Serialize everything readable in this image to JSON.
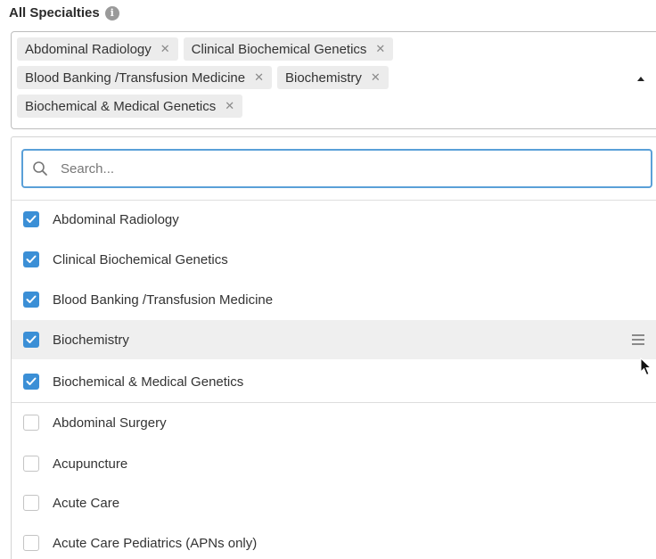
{
  "field": {
    "label": "All Specialties",
    "info_icon": "info-icon",
    "info_glyph": "i"
  },
  "selected_tags": [
    {
      "label": "Abdominal Radiology"
    },
    {
      "label": "Clinical Biochemical Genetics"
    },
    {
      "label": "Blood Banking /Transfusion Medicine"
    },
    {
      "label": "Biochemistry"
    },
    {
      "label": "Biochemical & Medical Genetics"
    }
  ],
  "tag_remove_glyph": "✕",
  "search": {
    "placeholder": "Search...",
    "value": ""
  },
  "options": [
    {
      "label": "Abdominal Radiology",
      "checked": true
    },
    {
      "label": "Clinical Biochemical Genetics",
      "checked": true
    },
    {
      "label": "Blood Banking /Transfusion Medicine",
      "checked": true
    },
    {
      "label": "Biochemistry",
      "checked": true,
      "hovered": true
    },
    {
      "label": "Biochemical & Medical Genetics",
      "checked": true
    },
    {
      "label": "Abdominal Surgery",
      "checked": false
    },
    {
      "label": "Acupuncture",
      "checked": false
    },
    {
      "label": "Acute Care",
      "checked": false
    },
    {
      "label": "Acute Care Pediatrics (APNs only)",
      "checked": false
    }
  ],
  "colors": {
    "accent": "#3b8fd6",
    "search_border": "#5aa0d8",
    "hover_row": "#efefef",
    "tag_bg": "#ececec"
  }
}
